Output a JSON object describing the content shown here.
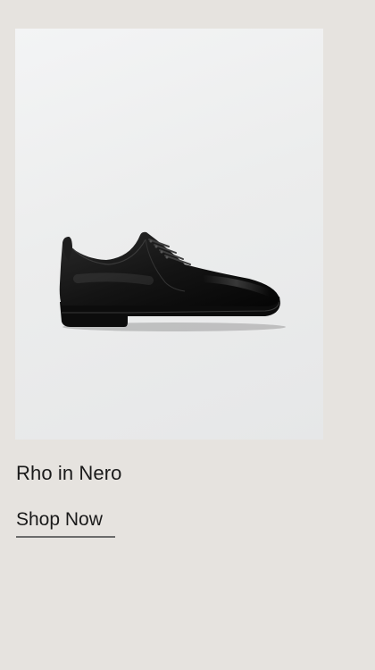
{
  "product": {
    "name": "Rho in Nero",
    "image_subject": "black leather derby shoe",
    "cta_label": "Shop Now"
  },
  "colors": {
    "page_background": "#e6e3df",
    "image_background": "#eceded",
    "text": "#1a1a1a",
    "underline": "#6b6b6b"
  }
}
